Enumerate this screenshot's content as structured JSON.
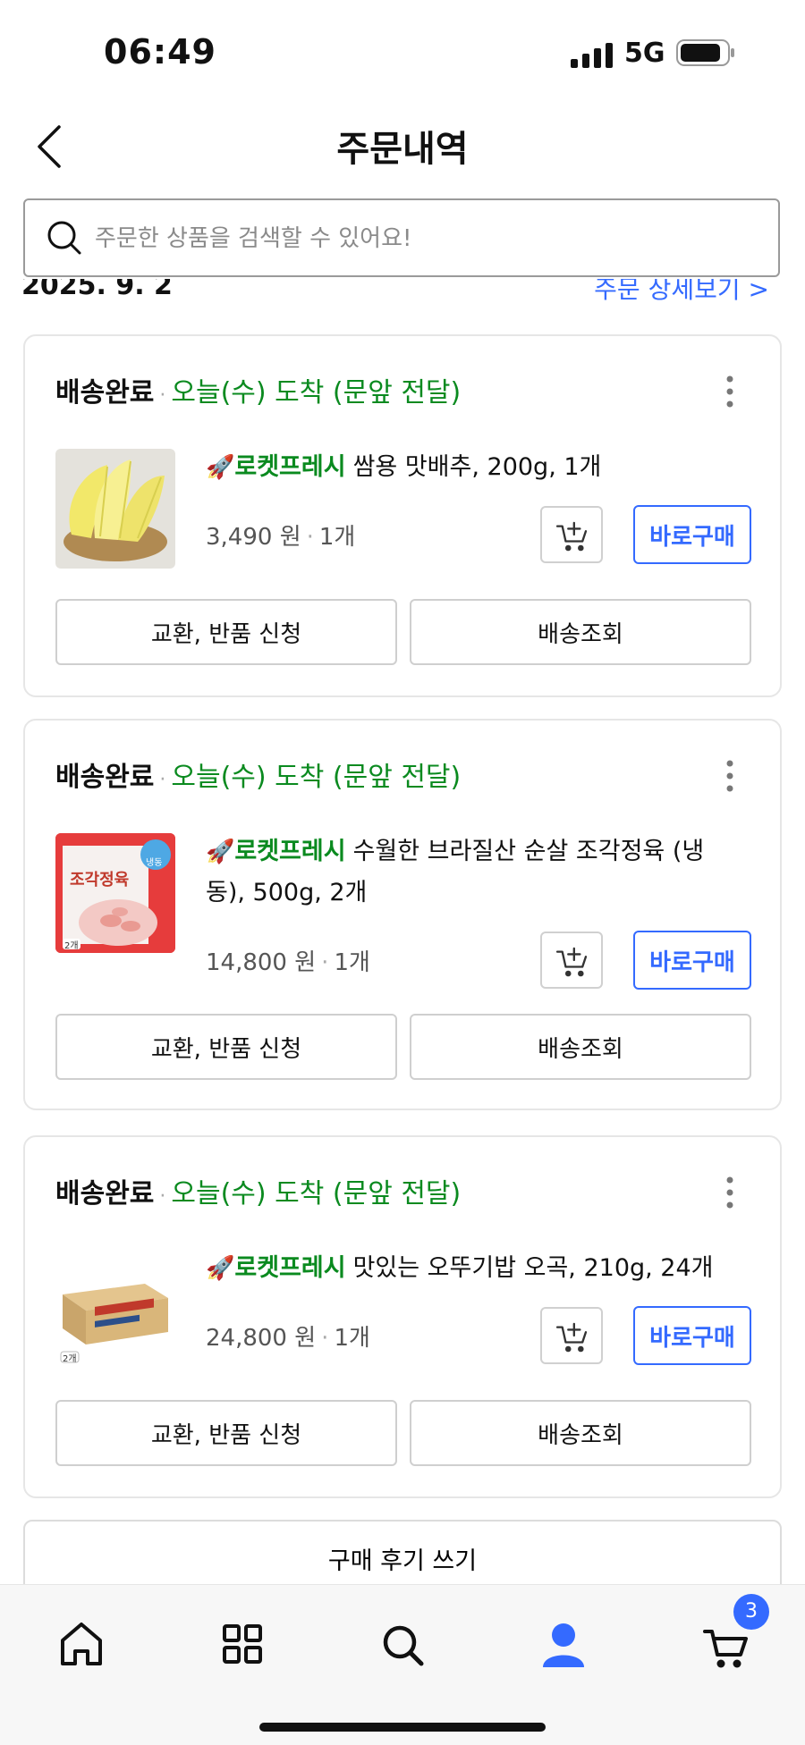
{
  "status_bar": {
    "time": "06:49",
    "network": "5G"
  },
  "header": {
    "title": "주문내역"
  },
  "search": {
    "placeholder": "주문한 상품을 검색할 수 있어요!"
  },
  "partial_header": {
    "date": "2025. 9. 2",
    "link": "주문 상세보기 >"
  },
  "orders": [
    {
      "status": "배송완료",
      "arrival": "오늘(수) 도착 (문앞 전달)",
      "badge": "로켓프레시",
      "product": "쌈용 맛배추, 200g, 1개",
      "price": "3,490 원",
      "qty": "1개",
      "buy_label": "바로구매",
      "exchange_label": "교환, 반품 신청",
      "tracking_label": "배송조회"
    },
    {
      "status": "배송완료",
      "arrival": "오늘(수) 도착 (문앞 전달)",
      "badge": "로켓프레시",
      "product": "수월한 브라질산 순살 조각정육 (냉동), 500g, 2개",
      "price": "14,800 원",
      "qty": "1개",
      "buy_label": "바로구매",
      "exchange_label": "교환, 반품 신청",
      "tracking_label": "배송조회",
      "thumb_text": "조각정육",
      "thumb_tag": "냉동",
      "thumb_count": "2개"
    },
    {
      "status": "배송완료",
      "arrival": "오늘(수) 도착 (문앞 전달)",
      "badge": "로켓프레시",
      "product": "맛있는 오뚜기밥 오곡, 210g, 24개",
      "price": "24,800 원",
      "qty": "1개",
      "buy_label": "바로구매",
      "exchange_label": "교환, 반품 신청",
      "tracking_label": "배송조회",
      "thumb_count": "2개"
    }
  ],
  "review_button": "구매 후기 쓰기",
  "tab_bar": {
    "items": [
      {
        "name": "home",
        "icon": "home-icon"
      },
      {
        "name": "categories",
        "icon": "grid-icon"
      },
      {
        "name": "search",
        "icon": "search-icon"
      },
      {
        "name": "my-page",
        "icon": "user-icon"
      },
      {
        "name": "cart",
        "icon": "cart-icon"
      }
    ],
    "cart_count": "3"
  },
  "colors": {
    "accent": "#346aff",
    "arrival_green": "#0a8a1f"
  }
}
